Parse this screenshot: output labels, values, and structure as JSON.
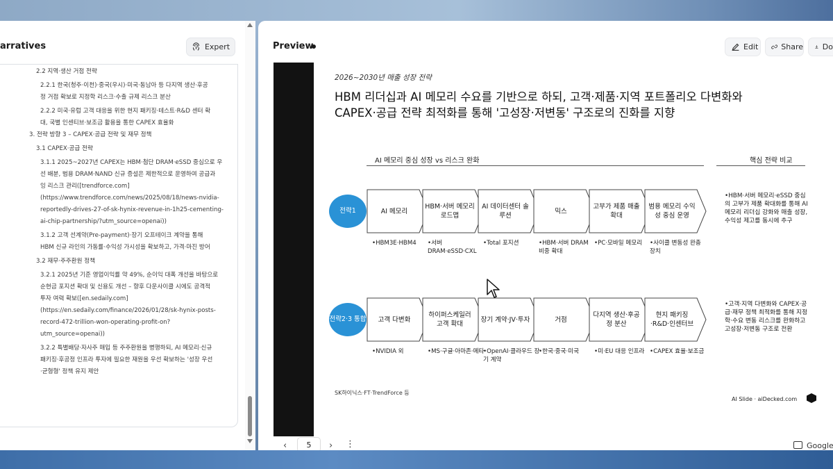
{
  "left": {
    "title": "arratives",
    "expert_label": "Expert",
    "outline": [
      {
        "indent": 1,
        "text": "2.2 지역·생산 거점 전략"
      },
      {
        "indent": 2,
        "text": "2.2.1 한국(청주·이천)·중국(우시)·미국·동남아 등 다지역 생산·후공"
      },
      {
        "indent": 2,
        "text": "정 거점 확보로 지정학 리스크·수출 규제 리스크 분산"
      },
      {
        "indent": 2,
        "text": "2.2.2 미국·유럽 고객 대응을 위한 현지 패키징·테스트·R&D 센터 확"
      },
      {
        "indent": 2,
        "text": "대, 국별 인센티브·보조금 활용을 통한 CAPEX 효율화"
      },
      {
        "indent": 0,
        "text": "3. 전략 방향 3 – CAPEX·공급 전략 및 재무 정책"
      },
      {
        "indent": 1,
        "text": "3.1 CAPEX·공급 전략"
      },
      {
        "indent": 2,
        "text": "3.1.1 2025~2027년 CAPEX는 HBM·첨단 DRAM·eSSD 중심으로 우"
      },
      {
        "indent": 2,
        "text": "선 배분, 범용 DRAM·NAND 신규 증설은 제한적으로 운영하여 공급과"
      },
      {
        "indent": 2,
        "text": "잉 리스크 관리([trendforce.com]"
      },
      {
        "indent": 2,
        "text": "(https://www.trendforce.com/news/2025/08/18/news-nvidia-"
      },
      {
        "indent": 2,
        "text": "reportedly-drives-27-of-sk-hynix-revenue-in-1h25-cementing-"
      },
      {
        "indent": 2,
        "text": "ai-chip-partnership/?utm_source=openai))"
      },
      {
        "indent": 2,
        "text": "3.1.2 고객 선계약(Pre-payment)·장기 오프테이크 계약을 통해"
      },
      {
        "indent": 2,
        "text": "HBM 신규 라인의 가동률·수익성 가시성을 확보하고, 가격·마진 방어"
      },
      {
        "indent": 1,
        "text": "3.2 재무·주주환원 정책"
      },
      {
        "indent": 2,
        "text": "3.2.1 2025년 기준 영업이익률 약 49%, 순이익 대폭 개선을 바탕으로"
      },
      {
        "indent": 2,
        "text": "순현금 포지션 확대 및 신용도 개선 – 향후 다운사이클 시에도 공격적"
      },
      {
        "indent": 2,
        "text": "투자 여력 확보([en.sedaily.com]"
      },
      {
        "indent": 2,
        "text": "(https://en.sedaily.com/finance/2026/01/28/sk-hynix-posts-"
      },
      {
        "indent": 2,
        "text": "record-472-trillion-won-operating-profit-on?"
      },
      {
        "indent": 2,
        "text": "utm_source=openai))"
      },
      {
        "indent": 2,
        "text": "3.2.2 특별배당·자사주 매입 등 주주환원을 병행하되, AI 메모리·신규"
      },
      {
        "indent": 2,
        "text": "패키징·후공정 인프라 투자에 필요한 재원을 우선 확보하는 '성장 우선"
      },
      {
        "indent": 2,
        "text": "·균형형' 정책 유지 제안"
      }
    ]
  },
  "preview": {
    "title": "Preview",
    "edit_label": "Edit",
    "share_label": "Share",
    "download_label": "Do",
    "page_number": "5",
    "google_label": "Google"
  },
  "slide": {
    "kicker": "2026~2030년 매출 성장 전략",
    "headline_1": "HBM 리더십과 AI 메모리 수요를 기반으로 하되, 고객·제품·지역 포트폴리오 다변화와",
    "headline_2": "CAPEX·공급 전략 최적화를 통해 '고성장·저변동' 구조로의 진화를 지향",
    "section_left": "AI 메모리 중심 성장 vs 리스크 완화",
    "section_right": "핵심 전략 비교",
    "rows": [
      {
        "label": "전략1",
        "steps": [
          "AI 메모리",
          "HBM·서버 메모리 로드맵",
          "AI 데이터센터 솔루션",
          "믹스",
          "고부가 제품 매출 확대",
          "범용 메모리 수익성 중심 운영"
        ],
        "notes": [
          "•HBM3E·HBM4",
          "•서버 DRAM·eSSD·CXL",
          "•Total 포지션",
          "•HBM·서버 DRAM 비중 확대",
          "•PC·모바일 메모리",
          "•사이클 변동성 완충 장치"
        ],
        "comparison": "•HBM·서버 메모리·eSSD 중심의 고부가 제품 확대화를 통해 AI 메모리 리더십 강화와 매출 성장, 수익성 제고를 동시에 추구"
      },
      {
        "label": "전략2·3 통합",
        "steps": [
          "고객 다변화",
          "하이퍼스케일러 고객 확대",
          "장기 계약·JV·투자",
          "거점",
          "다지역 생산·후공정 분산",
          "현지 패키징·R&D·인센터브"
        ],
        "notes": [
          "•NVIDIA 외",
          "•MS·구글·아마존·메타",
          "•OpenAI·클라우드 장기 계약",
          "•한국·중국·미국",
          "•미·EU 대응 인프라",
          "•CAPEX 효율·보조금"
        ],
        "comparison": "•고객·지역 다변화와 CAPEX·공급·재무 정책 최적화를 통해 지정학·수요 변동 리스크를 완화하고 고성장·저변동 구조로 전환"
      }
    ],
    "source": "SK하이닉스·FT·TrendForce 등",
    "brand": "AI Slide · aiDecked.com"
  },
  "colors": {
    "accent": "#2a92d6",
    "frame": "#121212"
  }
}
